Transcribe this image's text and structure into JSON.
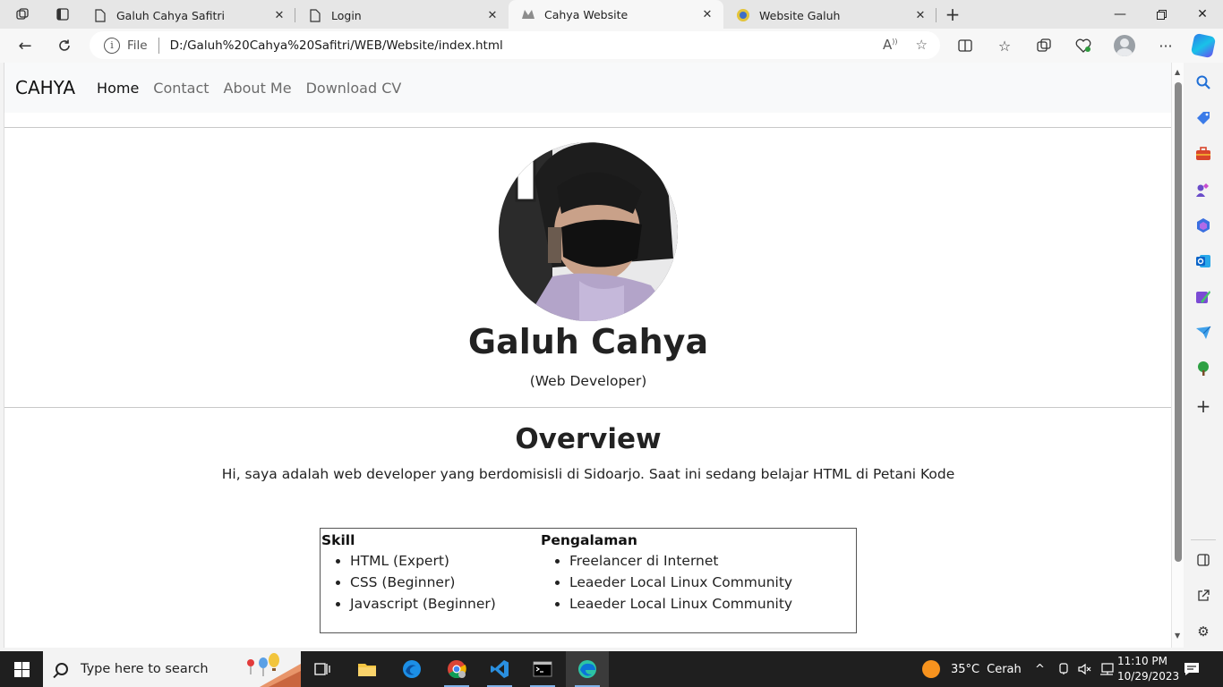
{
  "browser": {
    "tabs": [
      {
        "title": "Galuh Cahya Safitri",
        "active": false
      },
      {
        "title": "Login",
        "active": false
      },
      {
        "title": "Cahya Website",
        "active": true
      },
      {
        "title": "Website Galuh",
        "active": false
      }
    ],
    "address": {
      "scheme_label": "File",
      "url": "D:/Galuh%20Cahya%20Safitri/WEB/Website/index.html"
    }
  },
  "site": {
    "brand": "CAHYA",
    "nav": [
      "Home",
      "Contact",
      "About Me",
      "Download CV"
    ],
    "active_nav": "Home",
    "profile": {
      "name": "Galuh Cahya",
      "role": "(Web Developer)"
    },
    "overview": {
      "title": "Overview",
      "text": "Hi, saya adalah web developer yang berdomisisli di Sidoarjo. Saat ini sedang belajar HTML di Petani Kode"
    },
    "skill": {
      "heading": "Skill",
      "items": [
        "HTML (Expert)",
        "CSS (Beginner)",
        "Javascript (Beginner)"
      ]
    },
    "experience": {
      "heading": "Pengalaman",
      "items": [
        "Freelancer di Internet",
        "Leaeder Local Linux Community",
        "Leaeder Local Linux Community"
      ]
    }
  },
  "taskbar": {
    "search_placeholder": "Type here to search",
    "weather": {
      "temp": "35°C",
      "condition": "Cerah"
    },
    "time": "11:10 PM",
    "date": "10/29/2023"
  },
  "colors": {
    "accent": "#0078d4",
    "taskbar_bg": "#1f1f1f",
    "navbar_bg": "#f8f9fa"
  }
}
